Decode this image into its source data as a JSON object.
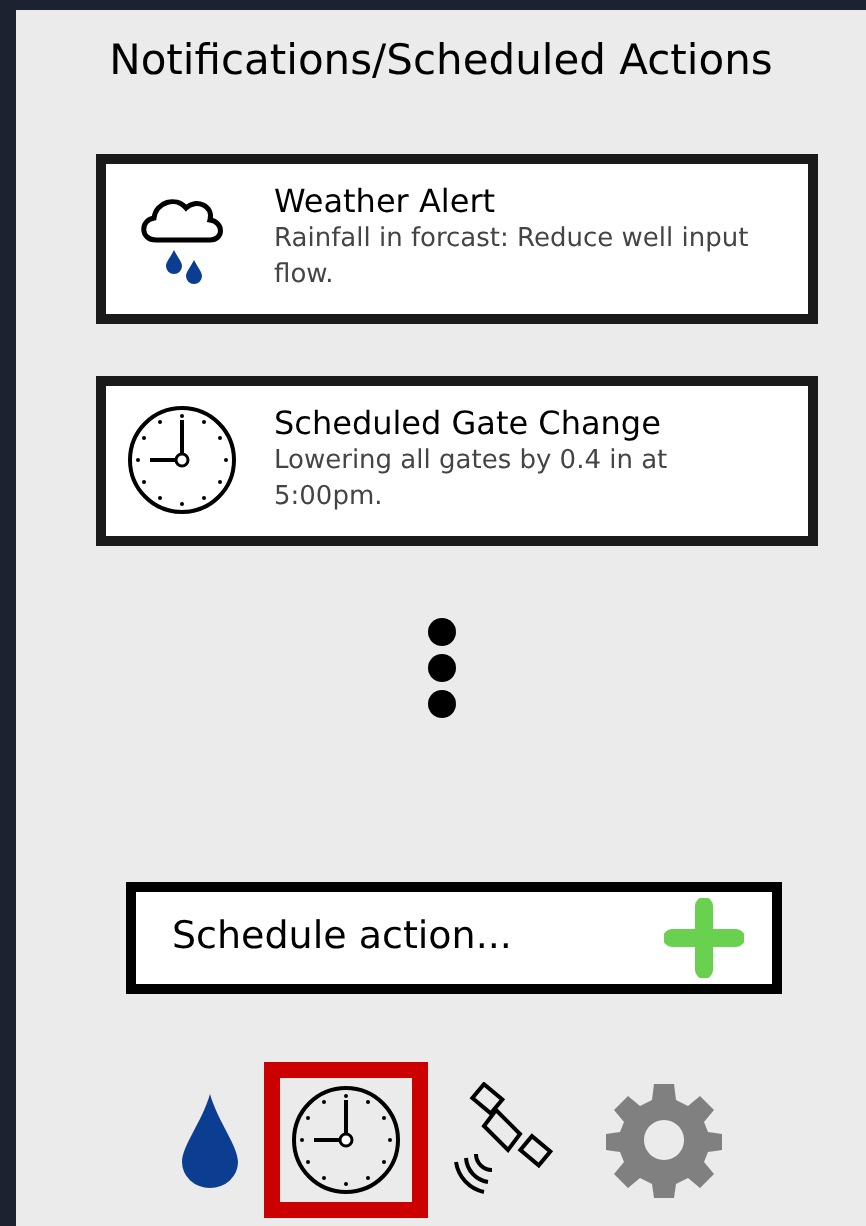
{
  "title": "Notifications/Scheduled Actions",
  "notifications": [
    {
      "kind": "weather",
      "title": "Weather Alert",
      "body": "Rainfall in forcast: Reduce well input flow."
    },
    {
      "kind": "clock",
      "title": "Scheduled Gate Change",
      "body": "Lowering all gates by 0.4 in at 5:00pm."
    }
  ],
  "schedule_button": {
    "label": "Schedule action..."
  },
  "nav": [
    {
      "kind": "water",
      "selected": false
    },
    {
      "kind": "clock",
      "selected": true
    },
    {
      "kind": "satellite",
      "selected": false
    },
    {
      "kind": "settings",
      "selected": false
    }
  ]
}
